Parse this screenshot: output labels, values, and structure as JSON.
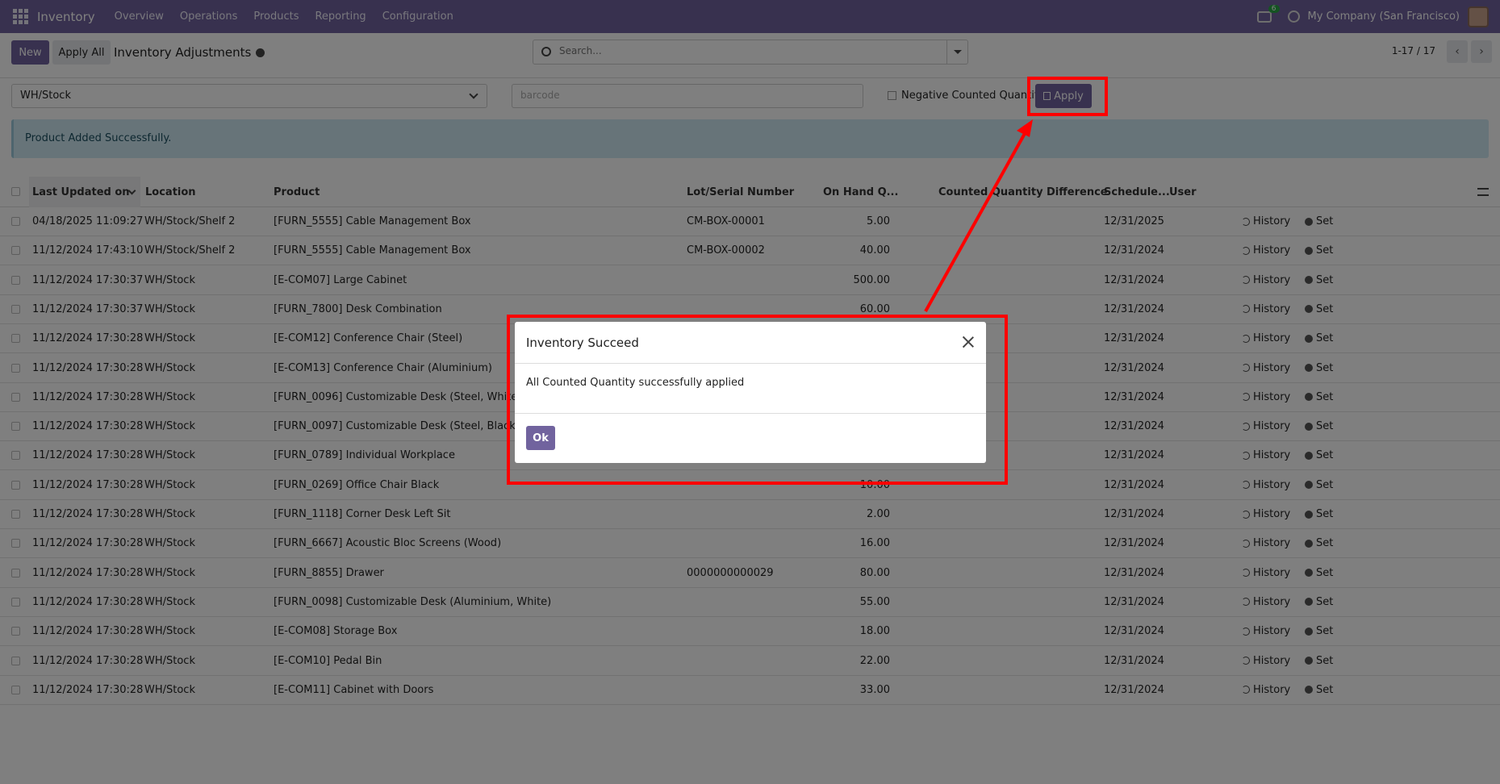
{
  "nav": {
    "brand": "Inventory",
    "menu": [
      "Overview",
      "Operations",
      "Products",
      "Reporting",
      "Configuration"
    ],
    "chat_count": "6",
    "company": "My Company (San Francisco)"
  },
  "control": {
    "new_label": "New",
    "apply_all_label": "Apply All",
    "title": "Inventory Adjustments",
    "search_placeholder": "Search...",
    "pager": "1-17 / 17"
  },
  "filters": {
    "location": "WH/Stock",
    "barcode_placeholder": "barcode",
    "negative_label": "Negative Counted Quantity",
    "apply_label": "Apply"
  },
  "alert": "Product Added Successfully.",
  "table": {
    "headers": [
      "Last Updated on",
      "Location",
      "Product",
      "Lot/Serial Number",
      "On Hand Q...",
      "Counted Quantity",
      "Difference",
      "Schedule...",
      "User"
    ],
    "history_label": "History",
    "set_label": "Set",
    "rows": [
      {
        "date": "04/18/2025 11:09:27",
        "location": "WH/Stock/Shelf 2",
        "product": "[FURN_5555] Cable Management Box",
        "lot": "CM-BOX-00001",
        "qty": "5.00",
        "sched": "12/31/2025"
      },
      {
        "date": "11/12/2024 17:43:10",
        "location": "WH/Stock/Shelf 2",
        "product": "[FURN_5555] Cable Management Box",
        "lot": "CM-BOX-00002",
        "qty": "40.00",
        "sched": "12/31/2024"
      },
      {
        "date": "11/12/2024 17:30:37",
        "location": "WH/Stock",
        "product": "[E-COM07] Large Cabinet",
        "lot": "",
        "qty": "500.00",
        "sched": "12/31/2024"
      },
      {
        "date": "11/12/2024 17:30:37",
        "location": "WH/Stock",
        "product": "[FURN_7800] Desk Combination",
        "lot": "",
        "qty": "60.00",
        "sched": "12/31/2024"
      },
      {
        "date": "11/12/2024 17:30:28",
        "location": "WH/Stock",
        "product": "[E-COM12] Conference Chair (Steel)",
        "lot": "",
        "qty": "",
        "sched": "12/31/2024"
      },
      {
        "date": "11/12/2024 17:30:28",
        "location": "WH/Stock",
        "product": "[E-COM13] Conference Chair (Aluminium)",
        "lot": "",
        "qty": "",
        "sched": "12/31/2024"
      },
      {
        "date": "11/12/2024 17:30:28",
        "location": "WH/Stock",
        "product": "[FURN_0096] Customizable Desk (Steel, White)",
        "lot": "",
        "qty": "",
        "sched": "12/31/2024"
      },
      {
        "date": "11/12/2024 17:30:28",
        "location": "WH/Stock",
        "product": "[FURN_0097] Customizable Desk (Steel, Black)",
        "lot": "",
        "qty": "",
        "sched": "12/31/2024"
      },
      {
        "date": "11/12/2024 17:30:28",
        "location": "WH/Stock",
        "product": "[FURN_0789] Individual Workplace",
        "lot": "",
        "qty": "",
        "sched": "12/31/2024"
      },
      {
        "date": "11/12/2024 17:30:28",
        "location": "WH/Stock",
        "product": "[FURN_0269] Office Chair Black",
        "lot": "",
        "qty": "10.00",
        "sched": "12/31/2024"
      },
      {
        "date": "11/12/2024 17:30:28",
        "location": "WH/Stock",
        "product": "[FURN_1118] Corner Desk Left Sit",
        "lot": "",
        "qty": "2.00",
        "sched": "12/31/2024"
      },
      {
        "date": "11/12/2024 17:30:28",
        "location": "WH/Stock",
        "product": "[FURN_6667] Acoustic Bloc Screens (Wood)",
        "lot": "",
        "qty": "16.00",
        "sched": "12/31/2024"
      },
      {
        "date": "11/12/2024 17:30:28",
        "location": "WH/Stock",
        "product": "[FURN_8855] Drawer",
        "lot": "0000000000029",
        "qty": "80.00",
        "sched": "12/31/2024"
      },
      {
        "date": "11/12/2024 17:30:28",
        "location": "WH/Stock",
        "product": "[FURN_0098] Customizable Desk (Aluminium, White)",
        "lot": "",
        "qty": "55.00",
        "sched": "12/31/2024"
      },
      {
        "date": "11/12/2024 17:30:28",
        "location": "WH/Stock",
        "product": "[E-COM08] Storage Box",
        "lot": "",
        "qty": "18.00",
        "sched": "12/31/2024"
      },
      {
        "date": "11/12/2024 17:30:28",
        "location": "WH/Stock",
        "product": "[E-COM10] Pedal Bin",
        "lot": "",
        "qty": "22.00",
        "sched": "12/31/2024"
      },
      {
        "date": "11/12/2024 17:30:28",
        "location": "WH/Stock",
        "product": "[E-COM11] Cabinet with Doors",
        "lot": "",
        "qty": "33.00",
        "sched": "12/31/2024"
      }
    ]
  },
  "modal": {
    "title": "Inventory Succeed",
    "body": "All Counted Quantity successfully applied",
    "ok_label": "Ok"
  },
  "colors": {
    "brand": "#71639e",
    "annotation": "#ff0000"
  }
}
